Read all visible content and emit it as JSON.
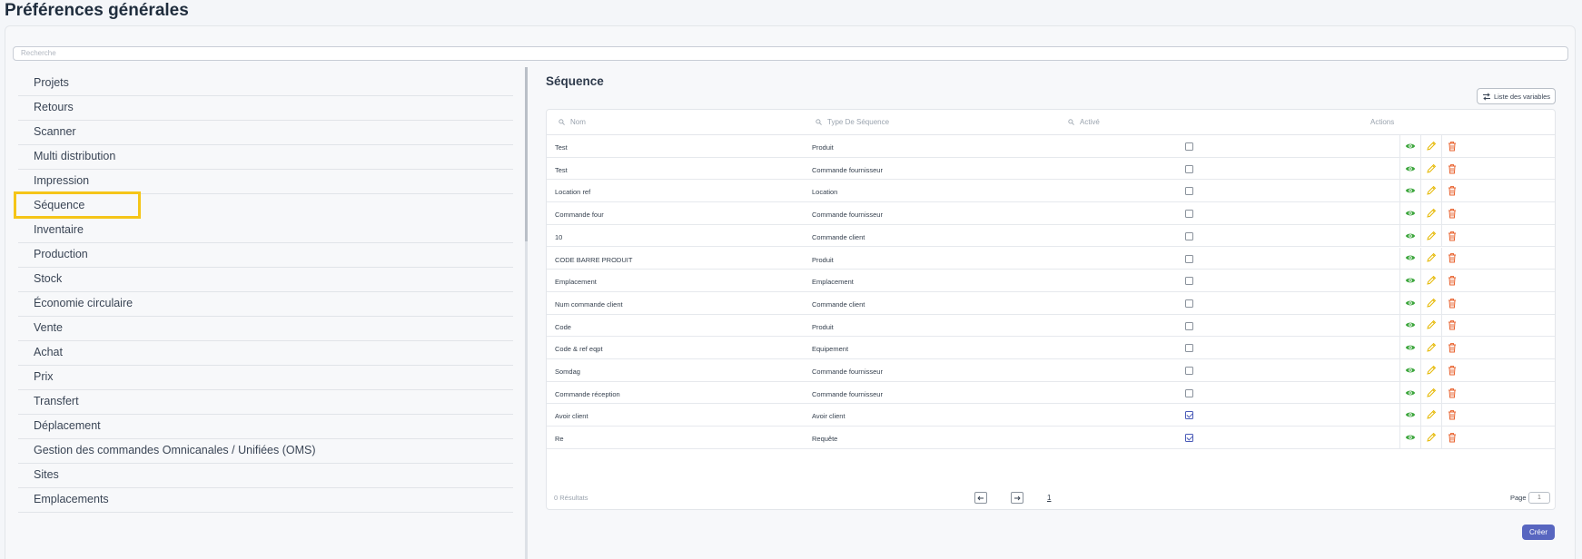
{
  "page": {
    "title": "Préférences générales"
  },
  "search": {
    "placeholder": "Recherche"
  },
  "sidebar": {
    "items": [
      {
        "label": "Projets"
      },
      {
        "label": "Retours"
      },
      {
        "label": "Scanner"
      },
      {
        "label": "Multi distribution"
      },
      {
        "label": "Impression"
      },
      {
        "label": "Séquence",
        "active": true
      },
      {
        "label": "Inventaire"
      },
      {
        "label": "Production"
      },
      {
        "label": "Stock"
      },
      {
        "label": "Économie circulaire"
      },
      {
        "label": "Vente"
      },
      {
        "label": "Achat"
      },
      {
        "label": "Prix"
      },
      {
        "label": "Transfert"
      },
      {
        "label": "Déplacement"
      },
      {
        "label": "Gestion des commandes Omnicanales / Unifiées (OMS)"
      },
      {
        "label": "Sites"
      },
      {
        "label": "Emplacements"
      }
    ]
  },
  "main": {
    "title": "Séquence",
    "variables_button": "Liste des variables",
    "columns": {
      "name": "Nom",
      "type": "Type De Séquence",
      "active": "Activé",
      "actions": "Actions"
    },
    "rows": [
      {
        "name": "Test",
        "type": "Produit",
        "active": false
      },
      {
        "name": "Test",
        "type": "Commande fournisseur",
        "active": false
      },
      {
        "name": "Location ref",
        "type": "Location",
        "active": false
      },
      {
        "name": "Commande four",
        "type": "Commande fournisseur",
        "active": false
      },
      {
        "name": "10",
        "type": "Commande client",
        "active": false
      },
      {
        "name": "CODE BARRE PRODUIT",
        "type": "Produit",
        "active": false
      },
      {
        "name": "Emplacement",
        "type": "Emplacement",
        "active": false
      },
      {
        "name": "Num commande client",
        "type": "Commande client",
        "active": false
      },
      {
        "name": "Code",
        "type": "Produit",
        "active": false
      },
      {
        "name": "Code & ref eqpt",
        "type": "Equipement",
        "active": false
      },
      {
        "name": "Somdag",
        "type": "Commande fournisseur",
        "active": false
      },
      {
        "name": "Commande réception",
        "type": "Commande fournisseur",
        "active": false
      },
      {
        "name": "Avoir client",
        "type": "Avoir client",
        "active": true
      },
      {
        "name": "Re",
        "type": "Requête",
        "active": true
      }
    ],
    "footer": {
      "results": "0 Résultats",
      "current_page": "1",
      "page_label": "Page",
      "page_input_placeholder": "1",
      "prev_icon": "arrow-left-icon",
      "next_icon": "arrow-right-icon"
    },
    "create_button": "Créer"
  },
  "colors": {
    "accent": "#5866c0",
    "highlight": "#f5c518",
    "view": "#3aa53a",
    "edit": "#e6b800",
    "delete": "#e8602c"
  }
}
